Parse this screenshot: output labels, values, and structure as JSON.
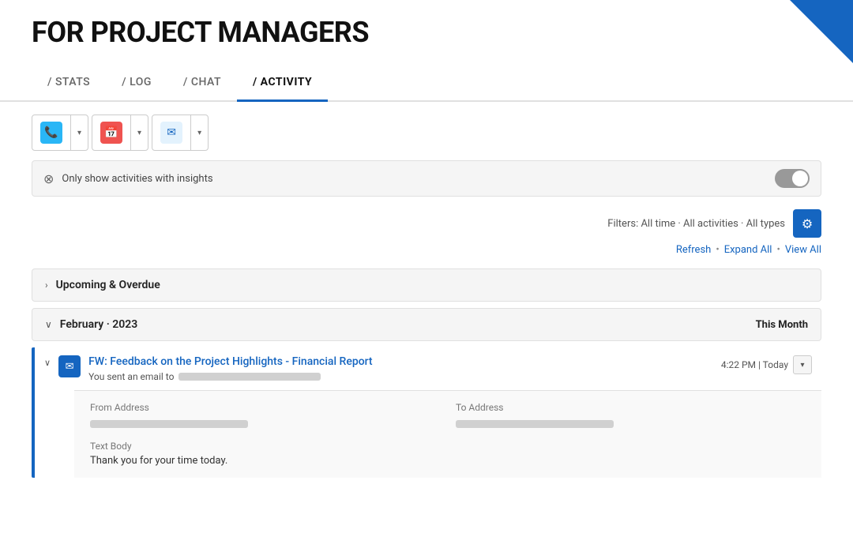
{
  "header": {
    "title": "FOR PROJECT MANAGERS"
  },
  "tabs": [
    {
      "id": "stats",
      "label": "/ STATS",
      "active": false
    },
    {
      "id": "log",
      "label": "/ LOG",
      "active": false
    },
    {
      "id": "chat",
      "label": "/ CHAT",
      "active": false
    },
    {
      "id": "activity",
      "label": "/ ACTIVITY",
      "active": true
    }
  ],
  "filters": {
    "label": "Filters: All time · All activities · All types",
    "refresh_label": "Refresh",
    "expand_all_label": "Expand All",
    "view_all_label": "View All"
  },
  "insights_bar": {
    "label": "Only show activities with insights"
  },
  "sections": [
    {
      "id": "upcoming-overdue",
      "title": "Upcoming & Overdue",
      "expanded": false,
      "right_label": ""
    },
    {
      "id": "feb-2023",
      "title": "February · 2023",
      "expanded": true,
      "right_label": "This Month"
    }
  ],
  "activity_item": {
    "title": "FW: Feedback on the Project Highlights - Financial Report",
    "time": "4:22 PM | Today",
    "subtitle_text": "You sent an email to",
    "from_label": "From Address",
    "to_label": "To Address",
    "text_body_label": "Text Body",
    "text_body": "Thank you for your time today."
  }
}
